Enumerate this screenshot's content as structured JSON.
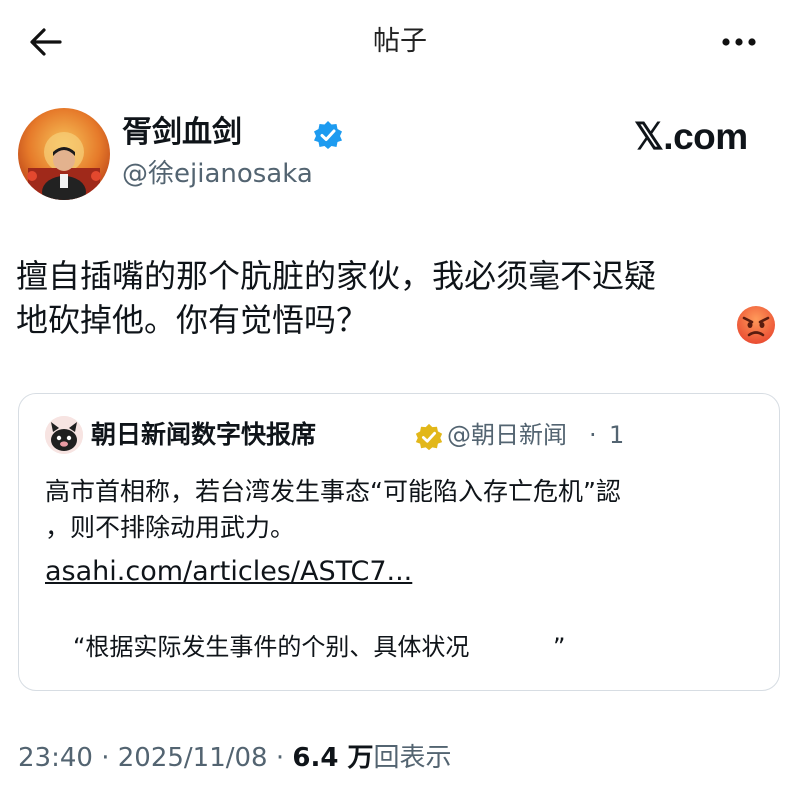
{
  "header": {
    "title": "帖子",
    "back_icon": "arrow-left-icon",
    "more_icon": "more-horizontal-icon"
  },
  "author": {
    "display_name": "胥剑血剑",
    "handle": "@徐ejianosaka",
    "verified_color": "#1d9bf0",
    "avatar_icon": "profile-photo"
  },
  "brand": {
    "label": "𝕏.com"
  },
  "post": {
    "lines": [
      "擅自插嘴的那个肮脏的家伙，我必须毫不迟疑",
      "地砍掉他。你有觉悟吗？"
    ],
    "emoji": "😡"
  },
  "quote": {
    "name": "朝日新闻数字快报席",
    "handle": "@朝日新闻",
    "separator": "·",
    "time": "1",
    "badge_color": "#e2b719",
    "lines": [
      "高市首相称，若台湾发生事态“可能陷入存亡危机”認",
      "，则不排除动用武力。"
    ],
    "link": "asahi.com/articles/ASTC7...",
    "excerpt": "“根据实际发生事件的个别、具体状况",
    "excerpt_end": "”"
  },
  "meta": {
    "time": "23:40",
    "separator": "·",
    "date": "2025/11/08",
    "views": "6.4 万",
    "views_label": "回表示"
  },
  "colors": {
    "text": "#0f1419",
    "muted": "#536471",
    "border": "#d7dde3"
  }
}
